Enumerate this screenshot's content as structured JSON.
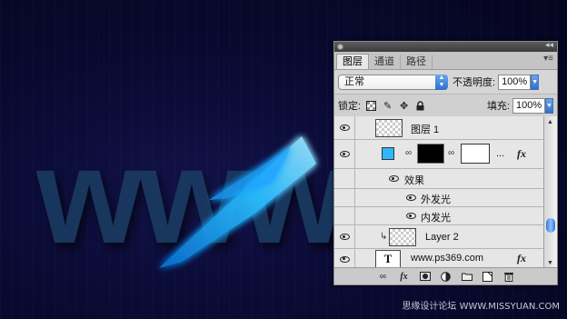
{
  "canvas": {
    "text": "www"
  },
  "panel": {
    "tabs": [
      {
        "label": "图层",
        "active": true
      },
      {
        "label": "通道",
        "active": false
      },
      {
        "label": "路径",
        "active": false
      }
    ],
    "blend_mode": "正常",
    "opacity_label": "不透明度:",
    "opacity_value": "100%",
    "lock_label": "锁定:",
    "fill_label": "填充:",
    "fill_value": "100%"
  },
  "layers": [
    {
      "name": "图层 1",
      "type": "raster"
    },
    {
      "name": "...",
      "type": "shape-with-mask",
      "fx": "fx"
    },
    {
      "name": "效果",
      "type": "effects-header"
    },
    {
      "name": "外发光",
      "type": "effect"
    },
    {
      "name": "内发光",
      "type": "effect"
    },
    {
      "name": "Layer 2",
      "type": "clipped-raster"
    },
    {
      "name": "www.ps369.com",
      "type": "text",
      "thumb_glyph": "T",
      "fx": "fx"
    }
  ],
  "bottom_icons": [
    "link-icon",
    "fx-icon",
    "mask-icon",
    "adjustment-icon",
    "group-folder-icon",
    "new-layer-icon",
    "trash-icon"
  ],
  "bottom_labels": {
    "fx": "fx"
  },
  "watermark": "思缘设计论坛 WWW.MISSYUAN.COM",
  "colors": {
    "shape_thumb": "#2fb8ff",
    "accent": "#2d6fd0",
    "glow": "#22aaff"
  }
}
